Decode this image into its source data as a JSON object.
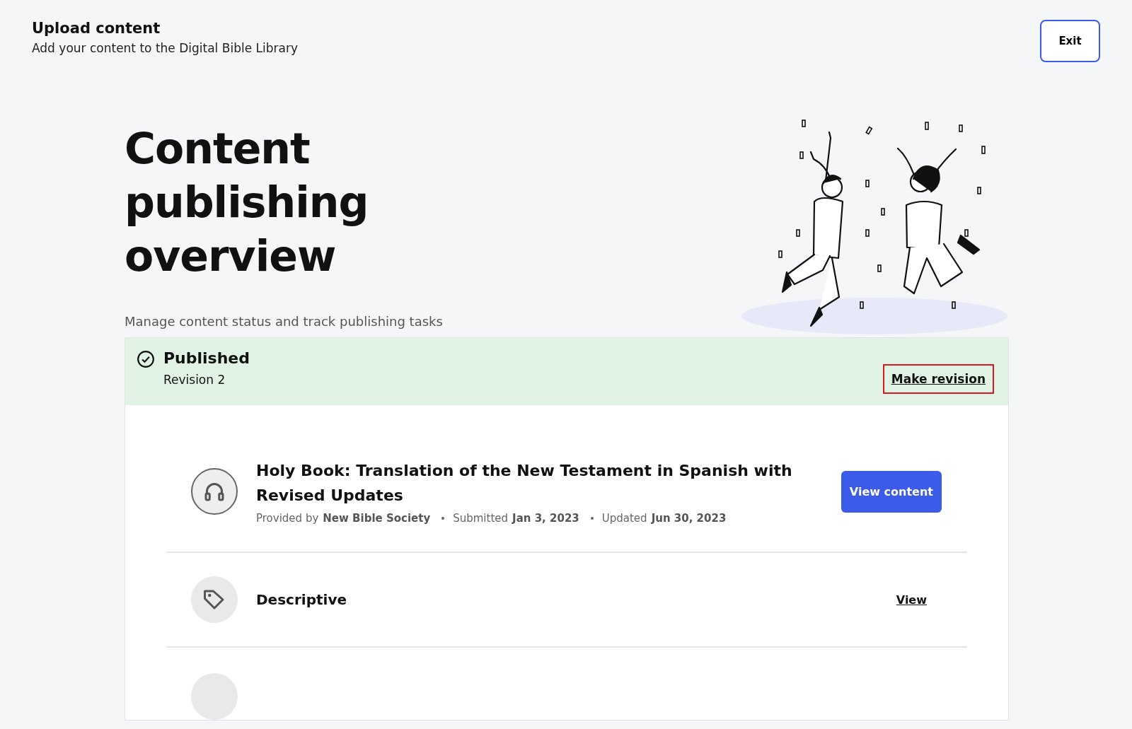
{
  "header": {
    "title": "Upload content",
    "subtitle": "Add your content to the Digital Bible Library",
    "exit_button": "Exit"
  },
  "hero": {
    "title": "Content publishing overview",
    "subtitle": "Manage content status and track publishing tasks"
  },
  "status": {
    "title": "Published",
    "revision": "Revision 2",
    "action": "Make revision",
    "action_focused": true
  },
  "content": {
    "title": "Holy Book: Translation of the New Testament in Spanish with Revised Updates",
    "meta": [
      {
        "label": "Provided by",
        "value": "New Bible Society"
      },
      {
        "label": "Submitted",
        "value": "Jan 3, 2023"
      },
      {
        "label": "Updated",
        "value": "Jun 30, 2023"
      }
    ],
    "button": "View content"
  },
  "sections": [
    {
      "kind": "tag",
      "label": "Descriptive",
      "action": "View"
    }
  ]
}
